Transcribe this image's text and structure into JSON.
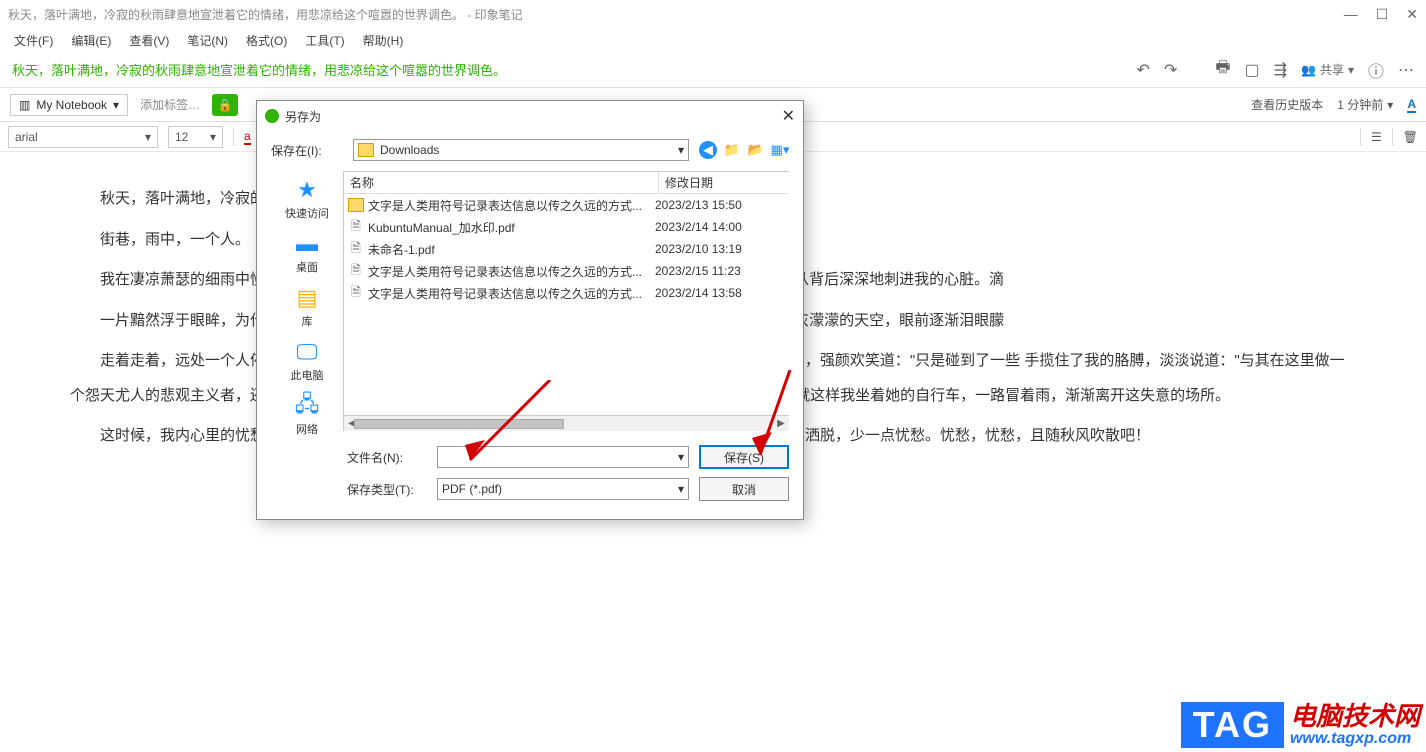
{
  "window": {
    "title": "秋天，落叶满地，冷寂的秋雨肆意地宣泄着它的情绪，用悲凉给这个喧嚣的世界调色。 - 印象笔记"
  },
  "menu": [
    "文件(F)",
    "编辑(E)",
    "查看(V)",
    "笔记(N)",
    "格式(O)",
    "工具(T)",
    "帮助(H)"
  ],
  "breadcrumb": "秋天，落叶满地，冷寂的秋雨肆意地宣泄着它的情绪，用悲凉给这个喧嚣的世界调色。",
  "share": "共享",
  "notebook_btn": "My Notebook",
  "add_tag": "添加标签…",
  "history": "查看历史版本",
  "timestamp": "1 分钟前",
  "font": {
    "family": "arial",
    "size": "12"
  },
  "body_paragraphs": [
    "秋天，落叶满地，冷寂的",
    "街巷，雨中，一个人。",
    "我在凄凉萧瑟的细雨中慢                                                                                                                                                        荡着朋友的背叛与谎言，家人的误会与训斥，它们就像是一把把闪着寒光的剑，从背后深深地刺进我的心脏。滴",
    "一片黯然浮于眼眸，为什                                                                                                                                                        不知名的叶子从我身旁飘落，这世界好似只有那一种颜色——冰冷的灰色。望向灰濛濛的天空，眼前逐渐泪眼朦",
    "走着走着，远处一个人停                                                                                                                                                        望着出神的我，皱着眉道：\"天呐，你咋了？谁欺负你了？\"我连忙擦了擦眼角的泪，强颜欢笑道：\"只是碰到了一些                                                                                                                                                    手揽住了我的胳膊，淡淡说道：\"与其在这里做一个怨天尤人的悲观主义者，还不如做一个仰望天空，对未来充满                                                                                                                                                    后我带你去吃好吃的。\"\"好\"，我看着她说道。就这样我坐着她的自行车，一路冒着雨，渐渐离开这失意的场所。",
    "这时候，我内心里的忧愁已了无踪影，内心已晴空万里。那一刻，温暖在我心中荡漾。青春的时刻，多一点洒脱，少一点忧愁。忧愁，忧愁，且随秋风吹散吧！"
  ],
  "dialog": {
    "title": "另存为",
    "savein_label": "保存在(I):",
    "savein_value": "Downloads",
    "sidebar": [
      {
        "label": "快速访问",
        "icon": "★",
        "color": "#1e90ff"
      },
      {
        "label": "桌面",
        "icon": "▬",
        "color": "#1e90ff"
      },
      {
        "label": "库",
        "icon": "▤",
        "color": "#ffb000"
      },
      {
        "label": "此电脑",
        "icon": "🖵",
        "color": "#1e90ff"
      },
      {
        "label": "网络",
        "icon": "🖧",
        "color": "#1e90ff"
      }
    ],
    "columns": {
      "name": "名称",
      "date": "修改日期"
    },
    "files": [
      {
        "type": "folder",
        "name": "文字是人类用符号记录表达信息以传之久远的方式...",
        "date": "2023/2/13 15:50"
      },
      {
        "type": "pdf",
        "name": "KubuntuManual_加水印.pdf",
        "date": "2023/2/14 14:00"
      },
      {
        "type": "pdf",
        "name": "未命名-1.pdf",
        "date": "2023/2/10 13:19"
      },
      {
        "type": "pdf",
        "name": "文字是人类用符号记录表达信息以传之久远的方式...",
        "date": "2023/2/15 11:23"
      },
      {
        "type": "pdf",
        "name": "文字是人类用符号记录表达信息以传之久远的方式...",
        "date": "2023/2/14 13:58"
      }
    ],
    "filename_label": "文件名(N):",
    "filename_value": "",
    "filetype_label": "保存类型(T):",
    "filetype_value": "PDF (*.pdf)",
    "save_btn": "保存(S)",
    "cancel_btn": "取消"
  },
  "watermark": {
    "tag": "TAG",
    "line1": "电脑技术网",
    "line2": "www.tagxp.com"
  }
}
